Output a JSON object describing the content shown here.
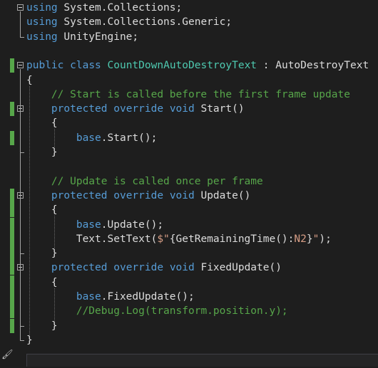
{
  "editor": {
    "lines": [
      {
        "segments": [
          {
            "c": "kw",
            "t": "using"
          },
          {
            "c": "tx",
            "t": " System.Collections;"
          }
        ]
      },
      {
        "segments": [
          {
            "c": "kw",
            "t": "using"
          },
          {
            "c": "tx",
            "t": " System.Collections.Generic;"
          }
        ]
      },
      {
        "segments": [
          {
            "c": "kw",
            "t": "using"
          },
          {
            "c": "tx",
            "t": " UnityEngine;"
          }
        ]
      },
      {
        "segments": []
      },
      {
        "segments": [
          {
            "c": "kw",
            "t": "public"
          },
          {
            "c": "tx",
            "t": " "
          },
          {
            "c": "kw",
            "t": "class"
          },
          {
            "c": "tx",
            "t": " "
          },
          {
            "c": "tp",
            "t": "CountDownAutoDestroyText"
          },
          {
            "c": "tx",
            "t": " : "
          },
          {
            "c": "tx",
            "t": "AutoDestroyText"
          }
        ]
      },
      {
        "segments": [
          {
            "c": "tx",
            "t": "{"
          }
        ]
      },
      {
        "segments": [
          {
            "c": "tx",
            "t": "    "
          },
          {
            "c": "cm",
            "t": "// Start is called before the first frame update"
          }
        ]
      },
      {
        "segments": [
          {
            "c": "tx",
            "t": "    "
          },
          {
            "c": "kw",
            "t": "protected"
          },
          {
            "c": "tx",
            "t": " "
          },
          {
            "c": "kw",
            "t": "override"
          },
          {
            "c": "tx",
            "t": " "
          },
          {
            "c": "kw",
            "t": "void"
          },
          {
            "c": "tx",
            "t": " Start()"
          }
        ]
      },
      {
        "segments": [
          {
            "c": "tx",
            "t": "    {"
          }
        ]
      },
      {
        "segments": [
          {
            "c": "tx",
            "t": "        "
          },
          {
            "c": "kw",
            "t": "base"
          },
          {
            "c": "tx",
            "t": ".Start();"
          }
        ]
      },
      {
        "segments": [
          {
            "c": "tx",
            "t": "    }"
          }
        ]
      },
      {
        "segments": []
      },
      {
        "segments": [
          {
            "c": "tx",
            "t": "    "
          },
          {
            "c": "cm",
            "t": "// Update is called once per frame"
          }
        ]
      },
      {
        "segments": [
          {
            "c": "tx",
            "t": "    "
          },
          {
            "c": "kw",
            "t": "protected"
          },
          {
            "c": "tx",
            "t": " "
          },
          {
            "c": "kw",
            "t": "override"
          },
          {
            "c": "tx",
            "t": " "
          },
          {
            "c": "kw",
            "t": "void"
          },
          {
            "c": "tx",
            "t": " Update()"
          }
        ]
      },
      {
        "segments": [
          {
            "c": "tx",
            "t": "    {"
          }
        ]
      },
      {
        "segments": [
          {
            "c": "tx",
            "t": "        "
          },
          {
            "c": "kw",
            "t": "base"
          },
          {
            "c": "tx",
            "t": ".Update();"
          }
        ]
      },
      {
        "segments": [
          {
            "c": "tx",
            "t": "        Text.SetText("
          },
          {
            "c": "st",
            "t": "$\""
          },
          {
            "c": "iv",
            "t": "{GetRemainingTime():"
          },
          {
            "c": "fm",
            "t": "N2"
          },
          {
            "c": "iv",
            "t": "}"
          },
          {
            "c": "st",
            "t": "\""
          },
          {
            "c": "tx",
            "t": ");"
          }
        ]
      },
      {
        "segments": [
          {
            "c": "tx",
            "t": "    }"
          }
        ]
      },
      {
        "segments": [
          {
            "c": "tx",
            "t": "    "
          },
          {
            "c": "kw",
            "t": "protected"
          },
          {
            "c": "tx",
            "t": " "
          },
          {
            "c": "kw",
            "t": "override"
          },
          {
            "c": "tx",
            "t": " "
          },
          {
            "c": "kw",
            "t": "void"
          },
          {
            "c": "tx",
            "t": " FixedUpdate()"
          }
        ]
      },
      {
        "segments": [
          {
            "c": "tx",
            "t": "    {"
          }
        ]
      },
      {
        "segments": [
          {
            "c": "tx",
            "t": "        "
          },
          {
            "c": "kw",
            "t": "base"
          },
          {
            "c": "tx",
            "t": ".FixedUpdate();"
          }
        ]
      },
      {
        "segments": [
          {
            "c": "tx",
            "t": "        "
          },
          {
            "c": "cm",
            "t": "//Debug.Log(transform.position.y);"
          }
        ]
      },
      {
        "segments": [
          {
            "c": "tx",
            "t": "    }"
          }
        ]
      },
      {
        "segments": [
          {
            "c": "tx",
            "t": "}"
          }
        ]
      }
    ],
    "change_marks": [
      4,
      7,
      9,
      13,
      14,
      15,
      16,
      17,
      18,
      19,
      20,
      21,
      22
    ],
    "fold_lines": [
      0,
      4,
      7,
      13,
      18
    ]
  },
  "colors": {
    "background": "#1e1e1e",
    "keyword": "#569cd6",
    "type": "#4ec9b0",
    "comment": "#57a64a",
    "string": "#d69d85",
    "text": "#dcdcdc",
    "change_mark": "#57a64a"
  },
  "statusbar": {
    "icon": "brush-icon"
  }
}
